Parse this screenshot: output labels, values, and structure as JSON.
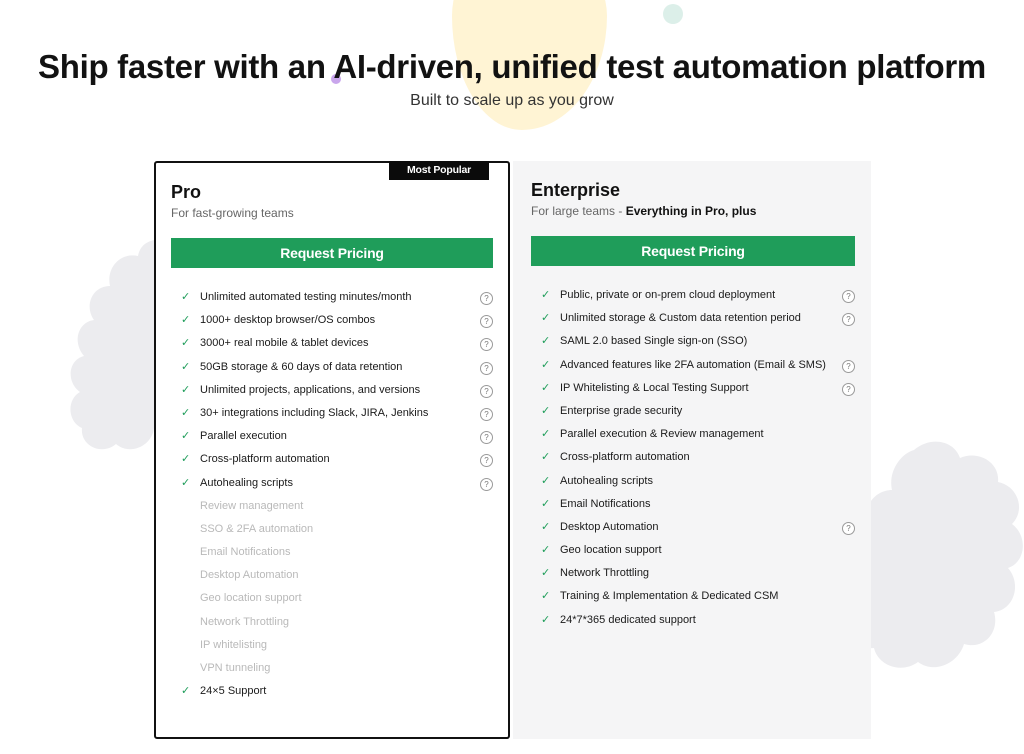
{
  "hero": {
    "title": "Ship faster with an AI-driven, unified test automation platform",
    "subtitle": "Built to scale up as you grow"
  },
  "plans": [
    {
      "name": "Pro",
      "badge": "Most Popular",
      "tagline": "For fast-growing teams",
      "cta": "Request Pricing",
      "features": [
        {
          "text": "Unlimited automated testing minutes/month",
          "included": true,
          "help": true
        },
        {
          "text": "1000+ desktop browser/OS combos",
          "included": true,
          "help": true
        },
        {
          "text": "3000+ real mobile & tablet devices",
          "included": true,
          "help": true
        },
        {
          "text": "50GB storage & 60 days of data retention",
          "included": true,
          "help": true
        },
        {
          "text": "Unlimited projects, applications, and versions",
          "included": true,
          "help": true
        },
        {
          "text": "30+ integrations including Slack, JIRA, Jenkins",
          "included": true,
          "help": true
        },
        {
          "text": "Parallel execution",
          "included": true,
          "help": true
        },
        {
          "text": "Cross-platform automation",
          "included": true,
          "help": true
        },
        {
          "text": "Autohealing scripts",
          "included": true,
          "help": true
        },
        {
          "text": "Review management",
          "included": false,
          "help": false
        },
        {
          "text": "SSO & 2FA automation",
          "included": false,
          "help": false
        },
        {
          "text": "Email Notifications",
          "included": false,
          "help": false
        },
        {
          "text": "Desktop Automation",
          "included": false,
          "help": false
        },
        {
          "text": "Geo location support",
          "included": false,
          "help": false
        },
        {
          "text": "Network Throttling",
          "included": false,
          "help": false
        },
        {
          "text": "IP whitelisting",
          "included": false,
          "help": false
        },
        {
          "text": "VPN tunneling",
          "included": false,
          "help": false
        },
        {
          "text": "24×5 Support",
          "included": true,
          "help": false
        }
      ]
    },
    {
      "name": "Enterprise",
      "tagline": "For large teams - ",
      "tagline_bold": "Everything in Pro, plus",
      "cta": "Request Pricing",
      "features": [
        {
          "text": "Public, private or on-prem cloud deployment",
          "included": true,
          "help": true
        },
        {
          "text": "Unlimited storage & Custom data retention period",
          "included": true,
          "help": true
        },
        {
          "text": "SAML 2.0 based Single sign-on (SSO)",
          "included": true,
          "help": false
        },
        {
          "text": "Advanced features like 2FA automation (Email & SMS)",
          "included": true,
          "help": true
        },
        {
          "text": "IP Whitelisting & Local Testing Support",
          "included": true,
          "help": true
        },
        {
          "text": "Enterprise grade security",
          "included": true,
          "help": false
        },
        {
          "text": "Parallel execution & Review management",
          "included": true,
          "help": false
        },
        {
          "text": "Cross-platform automation",
          "included": true,
          "help": false
        },
        {
          "text": "Autohealing scripts",
          "included": true,
          "help": false
        },
        {
          "text": "Email Notifications",
          "included": true,
          "help": false
        },
        {
          "text": "Desktop Automation",
          "included": true,
          "help": true
        },
        {
          "text": "Geo location support",
          "included": true,
          "help": false
        },
        {
          "text": "Network Throttling",
          "included": true,
          "help": false
        },
        {
          "text": "Training & Implementation & Dedicated CSM",
          "included": true,
          "help": false
        },
        {
          "text": "24*7*365 dedicated support",
          "included": true,
          "help": false
        }
      ]
    }
  ],
  "icons": {
    "check": "✓",
    "help": "?"
  },
  "colors": {
    "accent": "#1f9d5a",
    "badge_bg": "#0b0b0b",
    "enterprise_bg": "#f5f5f6",
    "disabled_text": "#b9b9b9"
  }
}
